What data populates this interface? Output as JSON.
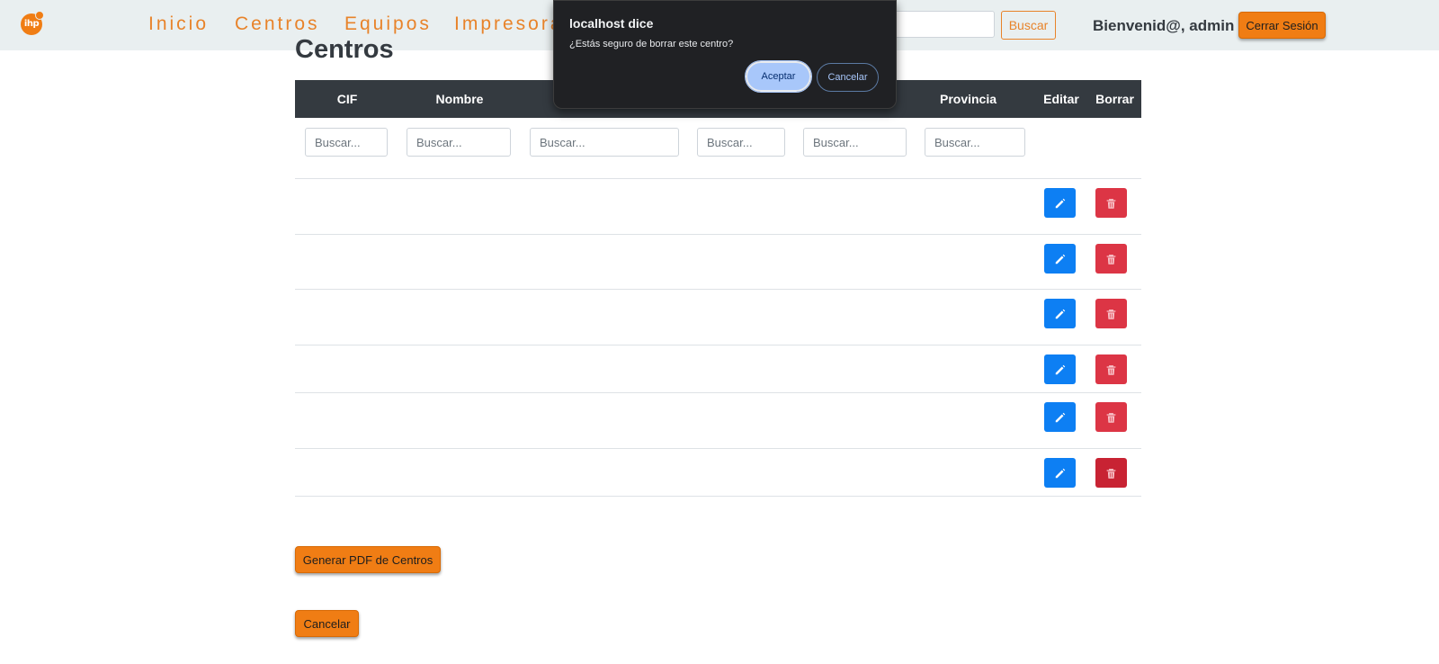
{
  "navbar": {
    "logo_text": "ihp",
    "links": [
      "Inicio",
      "Centros",
      "Equipos",
      "Impresora"
    ],
    "search_button": "Buscar",
    "welcome": "Bienvenid@, admin",
    "logout": "Cerrar Sesión"
  },
  "page": {
    "title": "Centros"
  },
  "table": {
    "headers": [
      "CIF",
      "Nombre",
      "Provincia",
      "Editar",
      "Borrar"
    ],
    "filter_placeholder": "Buscar...",
    "row_count": 6
  },
  "actions": {
    "pdf_button": "Generar PDF de Centros",
    "cancel_button": "Cancelar"
  },
  "dialog": {
    "title": "localhost dice",
    "message": "¿Estás seguro de borrar este centro?",
    "ok": "Aceptar",
    "cancel": "Cancelar"
  },
  "colors": {
    "accent": "#f07d14",
    "edit": "#0d7ff3",
    "delete": "#dc3545"
  },
  "icons": {
    "edit": "pencil-icon",
    "delete": "trash-icon"
  }
}
